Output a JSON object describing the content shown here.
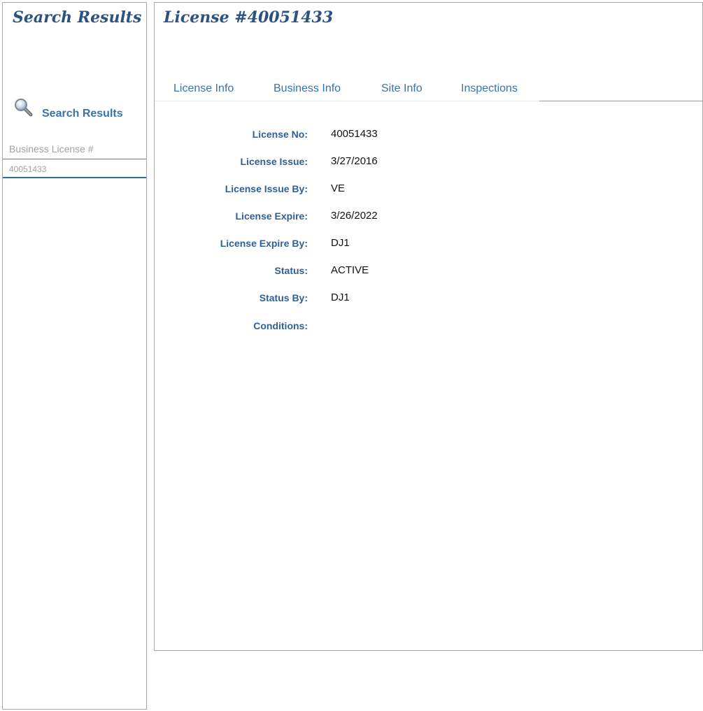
{
  "sidebar": {
    "title": "Search Results",
    "search_label": "Search Results",
    "icon": "magnifier-icon",
    "results_header": "Business License #",
    "results": [
      {
        "license_number": "40051433"
      }
    ]
  },
  "main": {
    "title": "License #40051433",
    "tabs": [
      {
        "label": "License Info"
      },
      {
        "label": "Business Info"
      },
      {
        "label": "Site Info"
      },
      {
        "label": "Inspections"
      }
    ],
    "fields": [
      {
        "label": "License No:",
        "value": "40051433"
      },
      {
        "label": "License Issue:",
        "value": "3/27/2016"
      },
      {
        "label": "License Issue By:",
        "value": "VE"
      },
      {
        "label": "License Expire:",
        "value": "3/26/2022"
      },
      {
        "label": "License Expire By:",
        "value": "DJ1"
      },
      {
        "label": "Status:",
        "value": "ACTIVE"
      },
      {
        "label": "Status By:",
        "value": "DJ1"
      },
      {
        "label": "Conditions:",
        "value": ""
      }
    ]
  },
  "colors": {
    "title": "#2c5282",
    "link": "#3a73a8",
    "label": "#2f5f93",
    "muted": "#a0a0a0",
    "row_underline": "#2f6aa3"
  }
}
